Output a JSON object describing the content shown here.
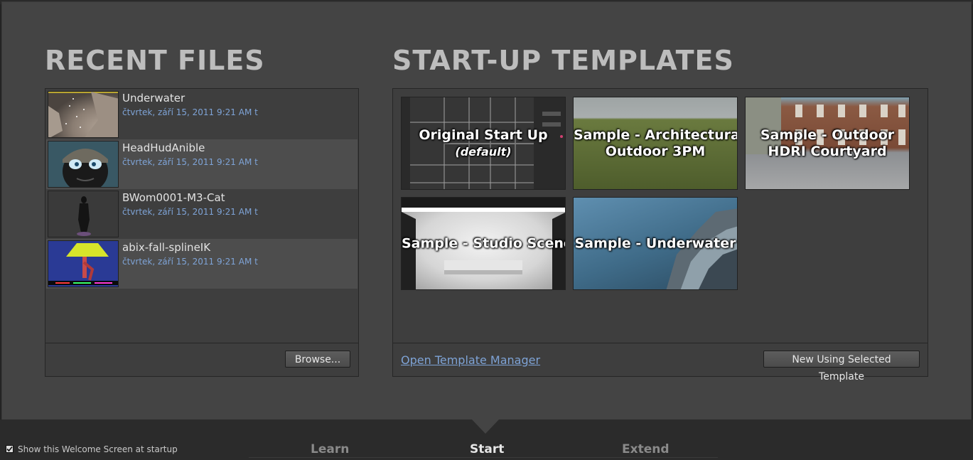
{
  "recent_files": {
    "heading": "RECENT FILES",
    "items": [
      {
        "name": "Underwater",
        "date": "čtvrtek, září 15, 2011 9:21 AM t"
      },
      {
        "name": "HeadHudAnible",
        "date": "čtvrtek, září 15, 2011 9:21 AM t"
      },
      {
        "name": "BWom0001-M3-Cat",
        "date": "čtvrtek, září 15, 2011 9:21 AM t"
      },
      {
        "name": "abix-fall-splineIK",
        "date": "čtvrtek, září 15, 2011 9:21 AM t"
      }
    ],
    "browse_label": "Browse..."
  },
  "templates": {
    "heading": "START-UP TEMPLATES",
    "items": [
      {
        "line1": "Original Start Up",
        "line2": "(default)"
      },
      {
        "line1": "Sample - Architectural",
        "line2": "Outdoor 3PM"
      },
      {
        "line1": "Sample - Outdoor",
        "line2": "HDRI Courtyard"
      },
      {
        "line1": "Sample - Studio Scene",
        "line2": ""
      },
      {
        "line1": "Sample - Underwater",
        "line2": ""
      }
    ],
    "manager_link": "Open Template Manager",
    "new_button": "New Using Selected Template"
  },
  "tabs": [
    {
      "label": "Learn"
    },
    {
      "label": "Start"
    },
    {
      "label": "Extend"
    }
  ],
  "active_tab": "Start",
  "footer": {
    "checkbox_label": "Show this Welcome Screen at startup",
    "checked": true
  },
  "colors": {
    "panel_bg": "#444444",
    "date_text": "#7ea3d6",
    "heading": "#bdbdbd"
  }
}
